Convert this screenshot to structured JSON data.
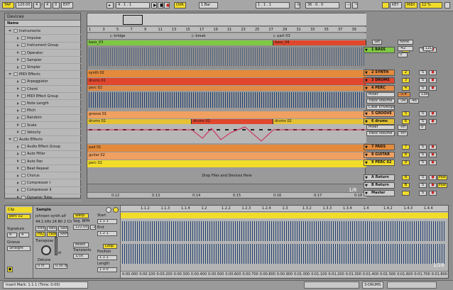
{
  "transport": {
    "tap": "TAP",
    "tempo": "120.00",
    "sig_num": "4",
    "sig_den": "4",
    "metro": "0",
    "ext": "EXT",
    "position": "4 . 1 . 1",
    "ovr": "OVR",
    "quant": "1 Bar",
    "loop_start": "1 . 1 . 1",
    "loop_len": "36 . 0 . 0",
    "key": "KEY",
    "midi": "MIDI",
    "cpu": "12 %"
  },
  "browser": {
    "title": "Devices",
    "col": "Name",
    "items": [
      {
        "label": "Instruments",
        "level": 0,
        "folder": true,
        "open": true
      },
      {
        "label": "Impulse",
        "level": 1,
        "folder": false
      },
      {
        "label": "Instrument Group",
        "level": 1,
        "folder": false
      },
      {
        "label": "Operator",
        "level": 1,
        "folder": false
      },
      {
        "label": "Sampler",
        "level": 1,
        "folder": false
      },
      {
        "label": "Simpler",
        "level": 1,
        "folder": false
      },
      {
        "label": "MIDI Effects",
        "level": 0,
        "folder": true,
        "open": true
      },
      {
        "label": "Arpeggiator",
        "level": 1,
        "folder": false
      },
      {
        "label": "Chord",
        "level": 1,
        "folder": false
      },
      {
        "label": "MIDI Effect Group",
        "level": 1,
        "folder": false
      },
      {
        "label": "Note Length",
        "level": 1,
        "folder": false
      },
      {
        "label": "Pitch",
        "level": 1,
        "folder": false
      },
      {
        "label": "Random",
        "level": 1,
        "folder": false
      },
      {
        "label": "Scale",
        "level": 1,
        "folder": false
      },
      {
        "label": "Velocity",
        "level": 1,
        "folder": false
      },
      {
        "label": "Audio Effects",
        "level": 0,
        "folder": true,
        "open": true
      },
      {
        "label": "Audio Effect Group",
        "level": 1,
        "folder": false
      },
      {
        "label": "Auto Filter",
        "level": 1,
        "folder": false
      },
      {
        "label": "Auto Pan",
        "level": 1,
        "folder": false
      },
      {
        "label": "Beat Repeat",
        "level": 1,
        "folder": false
      },
      {
        "label": "Chorus",
        "level": 1,
        "folder": false
      },
      {
        "label": "Compressor I",
        "level": 1,
        "folder": false
      },
      {
        "label": "Compressor II",
        "level": 1,
        "folder": false
      },
      {
        "label": "Dynamic Tube",
        "level": 1,
        "folder": false
      }
    ]
  },
  "ruler": {
    "bars": [
      "1",
      "3",
      "5",
      "7",
      "9",
      "11",
      "13",
      "15",
      "17",
      "19",
      "21",
      "23",
      "25",
      "27",
      "29",
      "31",
      "33",
      "35",
      "37",
      "39"
    ],
    "locators": [
      "bridge",
      "break",
      "part 03"
    ],
    "times": [
      "0:12",
      "0:13",
      "0:14",
      "0:15",
      "0:16",
      "0:17",
      "0:18"
    ],
    "page": "1/8"
  },
  "clips": {
    "bass_a": "bass_03",
    "bass_b": "bass_04",
    "synth": "synth 02",
    "drums": "drums 01",
    "perc": "perc 02",
    "groove": "groove 01",
    "drums6_a": "drums 02",
    "drums6_b": "drums 02",
    "drums6_c": "drums 02",
    "pad": "pad 01",
    "guitar": "guitar 02",
    "perc9": "perc 02",
    "drop_text": "Drop Files and Devices Here"
  },
  "tracks": [
    {
      "name": "1 BASS",
      "num": "1",
      "color": "#7fc843"
    },
    {
      "name": "2 SYNTH",
      "num": "2",
      "color": "#e48a3a"
    },
    {
      "name": "3 DRUMS",
      "num": "3",
      "color": "#e0472d"
    },
    {
      "name": "4 PERC",
      "num": "4",
      "color": "#e08a46"
    },
    {
      "name": "5 GROOVE",
      "num": "5",
      "color": "#f0a060"
    },
    {
      "name": "6 drums",
      "num": "6",
      "color": "#e4c233"
    },
    {
      "name": "7 PADS",
      "num": "7",
      "color": "#e48a3a"
    },
    {
      "name": "8 GUITAR",
      "num": "8",
      "color": "#f0a060"
    },
    {
      "name": "9 PERC 02",
      "num": "9",
      "color": "#f2dc2a"
    },
    {
      "name": "A Return",
      "num": "A",
      "color": "#cccccc"
    },
    {
      "name": "B Return",
      "num": "B",
      "color": "#cccccc"
    },
    {
      "name": "Master",
      "num": "",
      "color": "#cccccc"
    }
  ],
  "track_controls": {
    "bass_in": "None",
    "bass_vol": "-42",
    "bass_pan": "12L",
    "bass_sends": "0",
    "perc_dev": "Mixer",
    "perc_param": "Track Volume",
    "perc_val1": "-3.4",
    "perc_val2": "13R",
    "perc_val3": "-34",
    "perc_val4": "-46",
    "perc_env": "Clear Envelope",
    "drums6_dev": "Mixer",
    "drums6_param": "Track Volume",
    "drums6_val": "-inf",
    "drums6_val2": "0",
    "drums6_val3": "-inf",
    "solo": "S",
    "post": "Post",
    "set": "Set"
  },
  "detail": {
    "clip_title": "Clip",
    "clip_name": "perc 02",
    "signature_label": "Signature",
    "sig_num": "4",
    "sig_den": "4",
    "groove_label": "Groove",
    "groove_val": "Straight",
    "sample_title": "Sample",
    "file": "johnsen synth.aif",
    "info": "44.1 kHz 24 Bit 2 Ch",
    "edit": "Edit",
    "rev": "Rev.",
    "save": "Save",
    "hiq": "HiQ",
    "fade": "Fade",
    "ram": "RAM",
    "transpose_label": "Transpose",
    "transpose_val": "0 st",
    "detune_label": "Detune",
    "detune_val": "0 ct",
    "db_val": "0.00 dB",
    "warp": "Warp",
    "seg_bpm_label": "Seg. BPM",
    "seg_bpm": "122.00",
    "beats": "Beats",
    "transients_label": "Transients",
    "transients_val": "1/16",
    "start_label": "Start",
    "start_val": "1  1  1",
    "end_label": "End",
    "end_val": "1  2  1",
    "loop": "Loop",
    "position_label": "Position",
    "position_val": "1  1  1",
    "length_label": "Length",
    "length_val": "1  0  0",
    "ruler": [
      "1.1.2",
      "1.1.3",
      "1.1.4",
      "1.2",
      "1.2.2",
      "1.2.3",
      "1.2.4",
      "1.3",
      "1.3.2",
      "1.3.3",
      "1.3.4",
      "1.4",
      "1.4.2",
      "1.4.3",
      "1.4.4"
    ],
    "times": [
      "0:00.000",
      "0:00.100",
      "0:00.200",
      "0:00.300",
      "0:00.400",
      "0:00.500",
      "0:00.600",
      "0:00.700",
      "0:00.800",
      "0:00.900",
      "0:01.000",
      "0:01.100",
      "0:01.200",
      "0:01.300",
      "0:01.400",
      "0:01.500",
      "0:01.600",
      "0:01.700",
      "0:01.800"
    ],
    "page": "1/16"
  },
  "status": {
    "text": "Insert Mark: 1.1.1 (Time: 0:00)",
    "track": "3-DRUMS"
  }
}
